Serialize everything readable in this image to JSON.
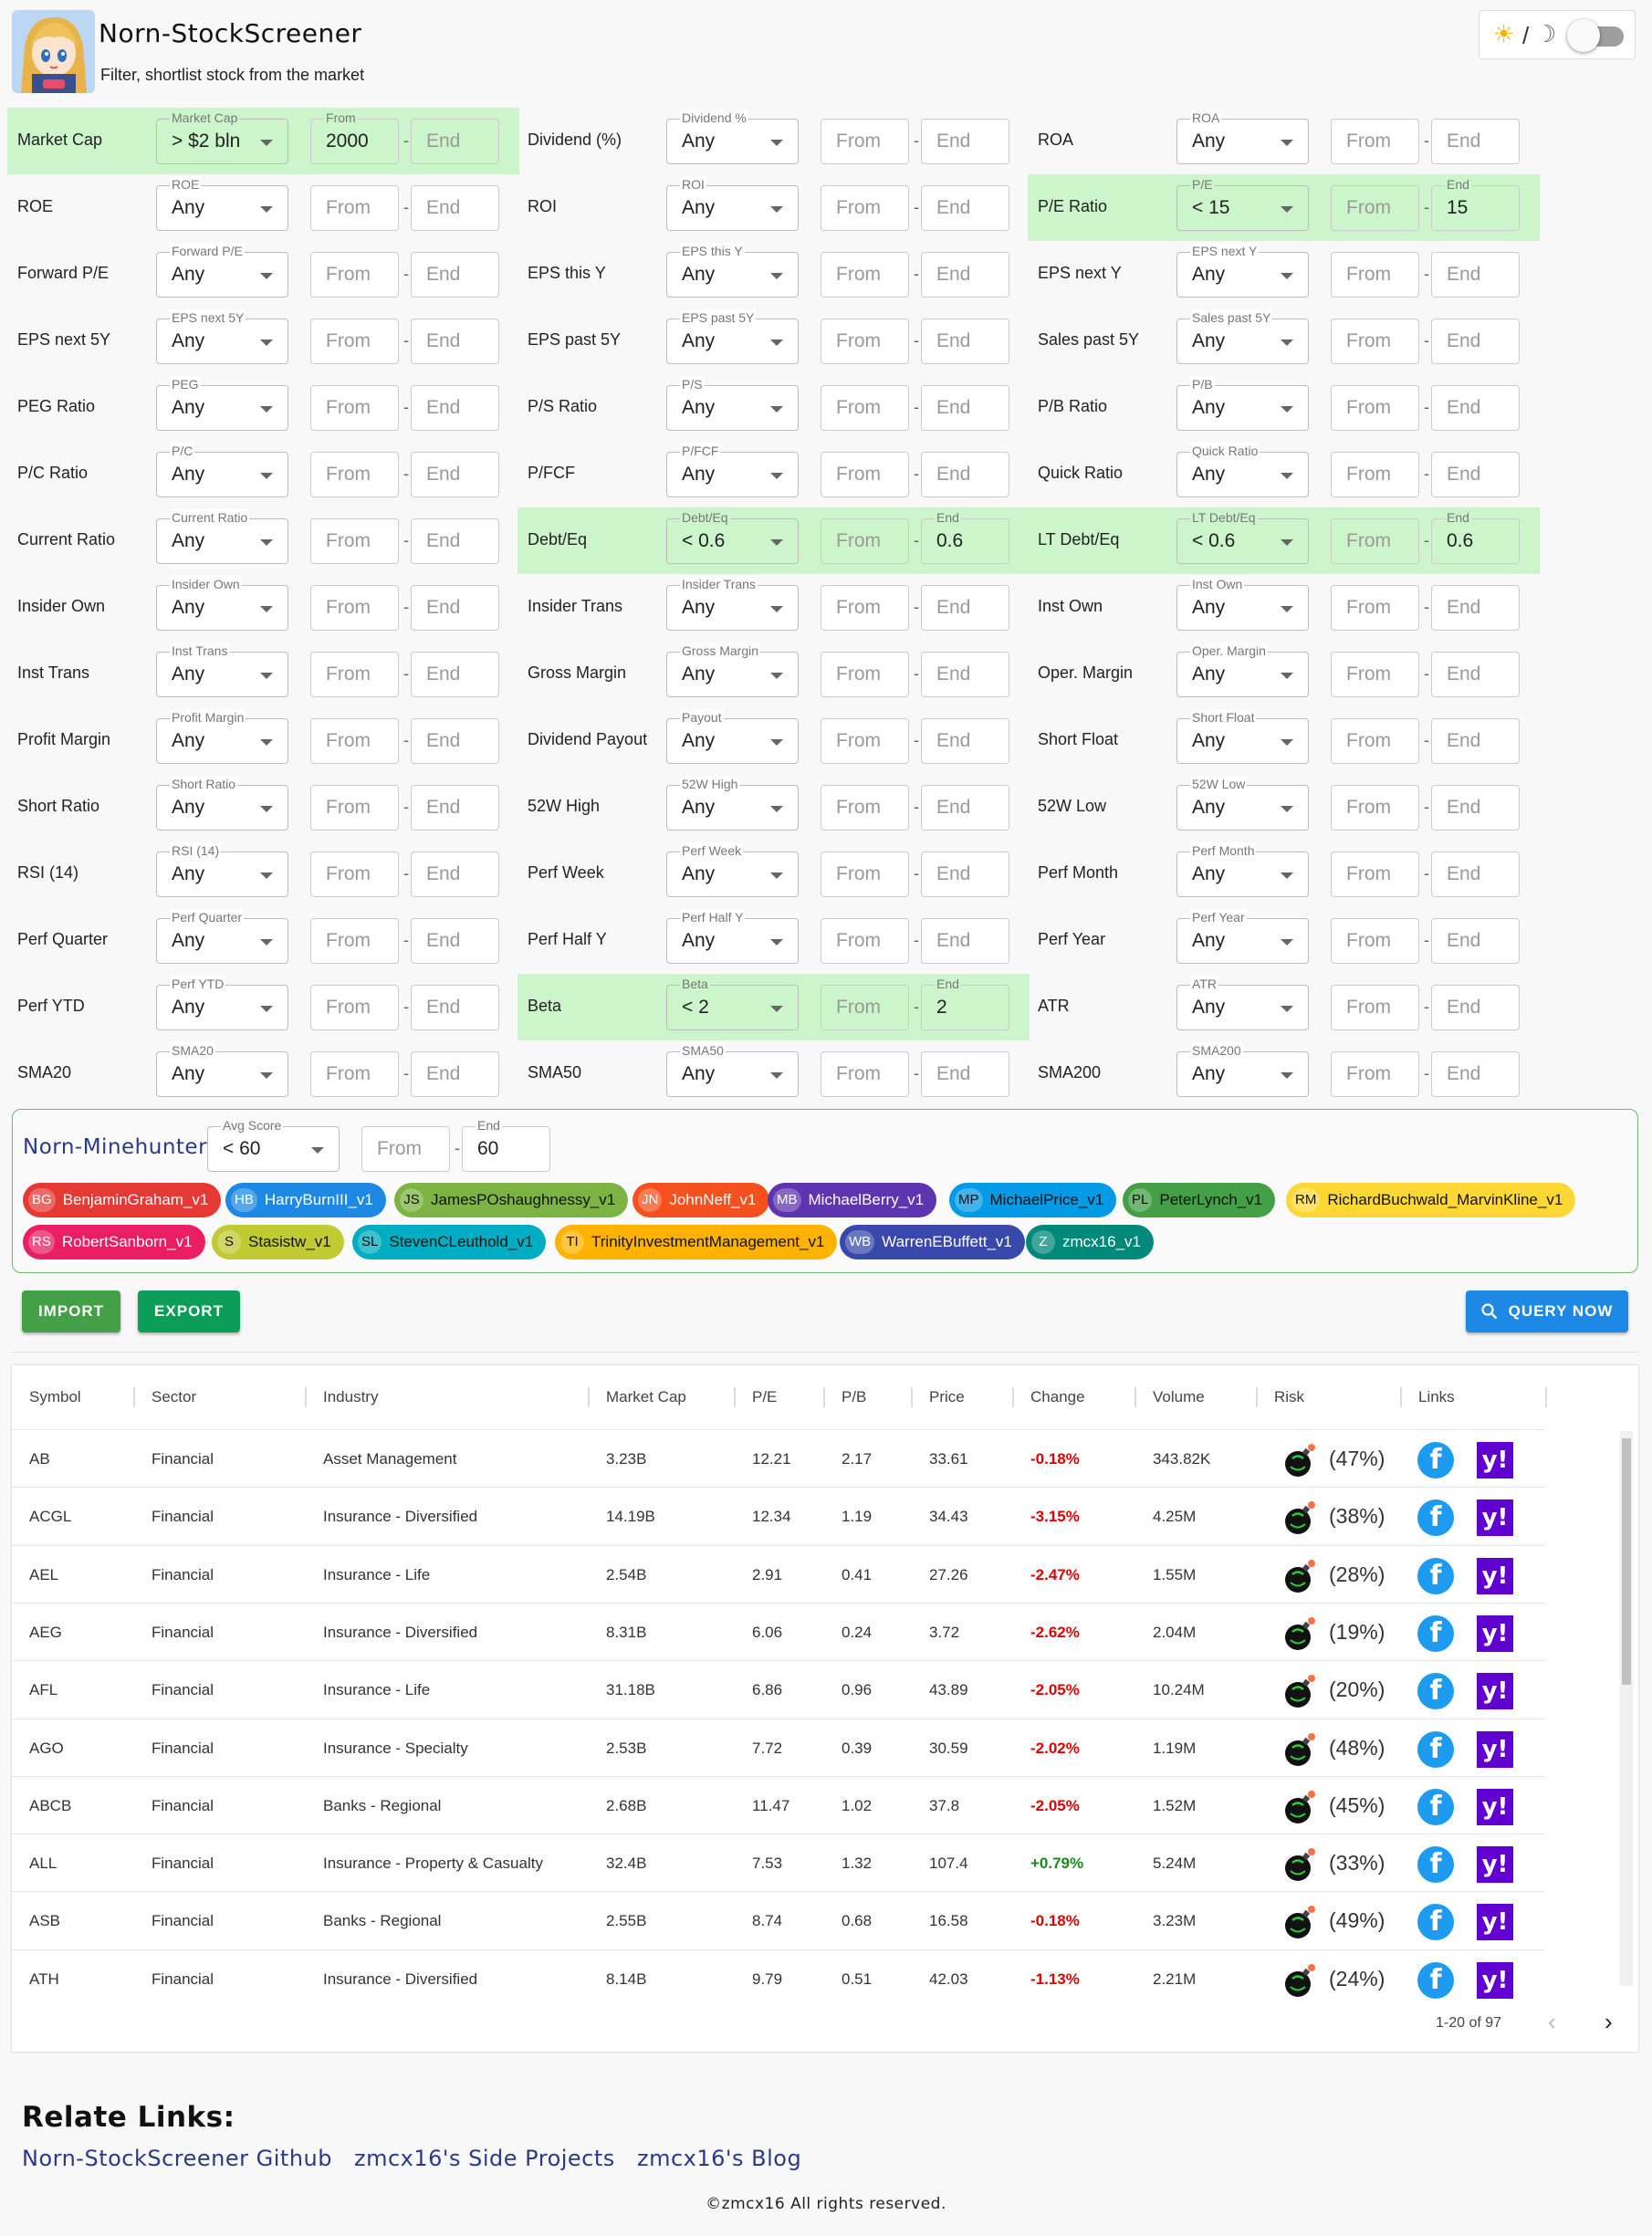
{
  "header": {
    "title": "Norn-StockScreener",
    "subtitle": "Filter, shortlist stock from the market",
    "theme_slash": "/",
    "sun_icon": "☀",
    "moon_icon": "☽"
  },
  "placeholders": {
    "from": "From",
    "end": "End"
  },
  "filters": [
    [
      {
        "label": "Market Cap",
        "legend": "Market Cap",
        "value": "> $2 bln",
        "from": "2000",
        "end": "",
        "from_legend": "From",
        "end_legend": "",
        "hl": true
      },
      {
        "label": "Dividend (%)",
        "legend": "Dividend %",
        "value": "Any",
        "from": "",
        "end": "",
        "hl": false
      },
      {
        "label": "ROA",
        "legend": "ROA",
        "value": "Any",
        "from": "",
        "end": "",
        "hl": false
      }
    ],
    [
      {
        "label": "ROE",
        "legend": "ROE",
        "value": "Any",
        "from": "",
        "end": "",
        "hl": false
      },
      {
        "label": "ROI",
        "legend": "ROI",
        "value": "Any",
        "from": "",
        "end": "",
        "hl": false
      },
      {
        "label": "P/E Ratio",
        "legend": "P/E",
        "value": "< 15",
        "from": "",
        "end": "15",
        "from_legend": "",
        "end_legend": "End",
        "hl": true
      }
    ],
    [
      {
        "label": "Forward P/E",
        "legend": "Forward P/E",
        "value": "Any",
        "from": "",
        "end": "",
        "hl": false
      },
      {
        "label": "EPS this Y",
        "legend": "EPS this Y",
        "value": "Any",
        "from": "",
        "end": "",
        "hl": false
      },
      {
        "label": "EPS next Y",
        "legend": "EPS next Y",
        "value": "Any",
        "from": "",
        "end": "",
        "hl": false
      }
    ],
    [
      {
        "label": "EPS next 5Y",
        "legend": "EPS next 5Y",
        "value": "Any",
        "from": "",
        "end": "",
        "hl": false
      },
      {
        "label": "EPS past 5Y",
        "legend": "EPS past 5Y",
        "value": "Any",
        "from": "",
        "end": "",
        "hl": false
      },
      {
        "label": "Sales past 5Y",
        "legend": "Sales past 5Y",
        "value": "Any",
        "from": "",
        "end": "",
        "hl": false
      }
    ],
    [
      {
        "label": "PEG Ratio",
        "legend": "PEG",
        "value": "Any",
        "from": "",
        "end": "",
        "hl": false
      },
      {
        "label": "P/S Ratio",
        "legend": "P/S",
        "value": "Any",
        "from": "",
        "end": "",
        "hl": false
      },
      {
        "label": "P/B Ratio",
        "legend": "P/B",
        "value": "Any",
        "from": "",
        "end": "",
        "hl": false
      }
    ],
    [
      {
        "label": "P/C Ratio",
        "legend": "P/C",
        "value": "Any",
        "from": "",
        "end": "",
        "hl": false
      },
      {
        "label": "P/FCF",
        "legend": "P/FCF",
        "value": "Any",
        "from": "",
        "end": "",
        "hl": false
      },
      {
        "label": "Quick Ratio",
        "legend": "Quick Ratio",
        "value": "Any",
        "from": "",
        "end": "",
        "hl": false
      }
    ],
    [
      {
        "label": "Current Ratio",
        "legend": "Current Ratio",
        "value": "Any",
        "from": "",
        "end": "",
        "hl": false
      },
      {
        "label": "Debt/Eq",
        "legend": "Debt/Eq",
        "value": "< 0.6",
        "from": "",
        "end": "0.6",
        "from_legend": "",
        "end_legend": "End",
        "hl": true
      },
      {
        "label": "LT Debt/Eq",
        "legend": "LT Debt/Eq",
        "value": "< 0.6",
        "from": "",
        "end": "0.6",
        "from_legend": "",
        "end_legend": "End",
        "hl": true
      }
    ],
    [
      {
        "label": "Insider Own",
        "legend": "Insider Own",
        "value": "Any",
        "from": "",
        "end": "",
        "hl": false
      },
      {
        "label": "Insider Trans",
        "legend": "Insider Trans",
        "value": "Any",
        "from": "",
        "end": "",
        "hl": false
      },
      {
        "label": "Inst Own",
        "legend": "Inst Own",
        "value": "Any",
        "from": "",
        "end": "",
        "hl": false
      }
    ],
    [
      {
        "label": "Inst Trans",
        "legend": "Inst Trans",
        "value": "Any",
        "from": "",
        "end": "",
        "hl": false
      },
      {
        "label": "Gross Margin",
        "legend": "Gross Margin",
        "value": "Any",
        "from": "",
        "end": "",
        "hl": false
      },
      {
        "label": "Oper. Margin",
        "legend": "Oper. Margin",
        "value": "Any",
        "from": "",
        "end": "",
        "hl": false
      }
    ],
    [
      {
        "label": "Profit Margin",
        "legend": "Profit Margin",
        "value": "Any",
        "from": "",
        "end": "",
        "hl": false
      },
      {
        "label": "Dividend Payout",
        "legend": "Payout",
        "value": "Any",
        "from": "",
        "end": "",
        "hl": false
      },
      {
        "label": "Short Float",
        "legend": "Short Float",
        "value": "Any",
        "from": "",
        "end": "",
        "hl": false
      }
    ],
    [
      {
        "label": "Short Ratio",
        "legend": "Short Ratio",
        "value": "Any",
        "from": "",
        "end": "",
        "hl": false
      },
      {
        "label": "52W High",
        "legend": "52W High",
        "value": "Any",
        "from": "",
        "end": "",
        "hl": false
      },
      {
        "label": "52W Low",
        "legend": "52W Low",
        "value": "Any",
        "from": "",
        "end": "",
        "hl": false
      }
    ],
    [
      {
        "label": "RSI (14)",
        "legend": "RSI (14)",
        "value": "Any",
        "from": "",
        "end": "",
        "hl": false
      },
      {
        "label": "Perf Week",
        "legend": "Perf Week",
        "value": "Any",
        "from": "",
        "end": "",
        "hl": false
      },
      {
        "label": "Perf Month",
        "legend": "Perf Month",
        "value": "Any",
        "from": "",
        "end": "",
        "hl": false
      }
    ],
    [
      {
        "label": "Perf Quarter",
        "legend": "Perf Quarter",
        "value": "Any",
        "from": "",
        "end": "",
        "hl": false
      },
      {
        "label": "Perf Half Y",
        "legend": "Perf Half Y",
        "value": "Any",
        "from": "",
        "end": "",
        "hl": false
      },
      {
        "label": "Perf Year",
        "legend": "Perf Year",
        "value": "Any",
        "from": "",
        "end": "",
        "hl": false
      }
    ],
    [
      {
        "label": "Perf YTD",
        "legend": "Perf YTD",
        "value": "Any",
        "from": "",
        "end": "",
        "hl": false
      },
      {
        "label": "Beta",
        "legend": "Beta",
        "value": "< 2",
        "from": "",
        "end": "2",
        "from_legend": "",
        "end_legend": "End",
        "hl": true
      },
      {
        "label": "ATR",
        "legend": "ATR",
        "value": "Any",
        "from": "",
        "end": "",
        "hl": false
      }
    ],
    [
      {
        "label": "SMA20",
        "legend": "SMA20",
        "value": "Any",
        "from": "",
        "end": "",
        "hl": false
      },
      {
        "label": "SMA50",
        "legend": "SMA50",
        "value": "Any",
        "from": "",
        "end": "",
        "hl": false
      },
      {
        "label": "SMA200",
        "legend": "SMA200",
        "value": "Any",
        "from": "",
        "end": "",
        "hl": false
      }
    ]
  ],
  "minehunter": {
    "title": "Norn-Minehunter",
    "legend": "Avg Score",
    "value": "< 60",
    "from": "",
    "end": "60",
    "end_legend": "End",
    "chips": [
      {
        "ini": "BG",
        "label": "BenjaminGraham_v1",
        "bg": "#e53935",
        "fg": "#ffffff"
      },
      {
        "ini": "HB",
        "label": "HarryBurnIII_v1",
        "bg": "#1e88e5",
        "fg": "#ffffff"
      },
      {
        "ini": "JS",
        "label": "JamesPOshaughnessy_v1",
        "bg": "#7cb342",
        "fg": "#111111"
      },
      {
        "ini": "JN",
        "label": "JohnNeff_v1",
        "bg": "#f4511e",
        "fg": "#ffffff"
      },
      {
        "ini": "MB",
        "label": "MichaelBerry_v1",
        "bg": "#5e35b1",
        "fg": "#ffffff"
      },
      {
        "ini": "MP",
        "label": "MichaelPrice_v1",
        "bg": "#039be5",
        "fg": "#111111"
      },
      {
        "ini": "PL",
        "label": "PeterLynch_v1",
        "bg": "#43a047",
        "fg": "#111111"
      },
      {
        "ini": "RM",
        "label": "RichardBuchwald_MarvinKline_v1",
        "bg": "#fdd835",
        "fg": "#111111"
      },
      {
        "ini": "RS",
        "label": "RobertSanborn_v1",
        "bg": "#e91e63",
        "fg": "#ffffff"
      },
      {
        "ini": "S",
        "label": "Stasistw_v1",
        "bg": "#c0ca33",
        "fg": "#111111"
      },
      {
        "ini": "SL",
        "label": "StevenCLeuthold_v1",
        "bg": "#00acc1",
        "fg": "#111111"
      },
      {
        "ini": "TI",
        "label": "TrinityInvestmentManagement_v1",
        "bg": "#ffb300",
        "fg": "#111111"
      },
      {
        "ini": "WB",
        "label": "WarrenEBuffett_v1",
        "bg": "#3949ab",
        "fg": "#ffffff"
      },
      {
        "ini": "Z",
        "label": "zmcx16_v1",
        "bg": "#00897b",
        "fg": "#ffffff"
      }
    ]
  },
  "actions": {
    "import": "IMPORT",
    "export": "EXPORT",
    "query": "QUERY NOW",
    "import_color": "#43a047",
    "export_color": "#0c9d58",
    "query_color": "#1e88e5"
  },
  "table": {
    "columns": [
      "Symbol",
      "Sector",
      "Industry",
      "Market Cap",
      "P/E",
      "P/B",
      "Price",
      "Change",
      "Volume",
      "Risk",
      "Links"
    ],
    "rows": [
      [
        "AB",
        "Financial",
        "Asset Management",
        "3.23B",
        "12.21",
        "2.17",
        "33.61",
        "-0.18%",
        "343.82K",
        "(47%)"
      ],
      [
        "ACGL",
        "Financial",
        "Insurance - Diversified",
        "14.19B",
        "12.34",
        "1.19",
        "34.43",
        "-3.15%",
        "4.25M",
        "(38%)"
      ],
      [
        "AEL",
        "Financial",
        "Insurance - Life",
        "2.54B",
        "2.91",
        "0.41",
        "27.26",
        "-2.47%",
        "1.55M",
        "(28%)"
      ],
      [
        "AEG",
        "Financial",
        "Insurance - Diversified",
        "8.31B",
        "6.06",
        "0.24",
        "3.72",
        "-2.62%",
        "2.04M",
        "(19%)"
      ],
      [
        "AFL",
        "Financial",
        "Insurance - Life",
        "31.18B",
        "6.86",
        "0.96",
        "43.89",
        "-2.05%",
        "10.24M",
        "(20%)"
      ],
      [
        "AGO",
        "Financial",
        "Insurance - Specialty",
        "2.53B",
        "7.72",
        "0.39",
        "30.59",
        "-2.02%",
        "1.19M",
        "(48%)"
      ],
      [
        "ABCB",
        "Financial",
        "Banks - Regional",
        "2.68B",
        "11.47",
        "1.02",
        "37.8",
        "-2.05%",
        "1.52M",
        "(45%)"
      ],
      [
        "ALL",
        "Financial",
        "Insurance - Property & Casualty",
        "32.4B",
        "7.53",
        "1.32",
        "107.4",
        "+0.79%",
        "5.24M",
        "(33%)"
      ],
      [
        "ASB",
        "Financial",
        "Banks - Regional",
        "2.55B",
        "8.74",
        "0.68",
        "16.58",
        "-0.18%",
        "3.23M",
        "(49%)"
      ],
      [
        "ATH",
        "Financial",
        "Insurance - Diversified",
        "8.14B",
        "9.79",
        "0.51",
        "42.03",
        "-1.13%",
        "2.21M",
        "(24%)"
      ]
    ],
    "pagination": "1-20 of 97",
    "prev_icon": "‹",
    "next_icon": "›",
    "links_icons": {
      "fb": "f",
      "yahoo": "y!"
    }
  },
  "related": {
    "title": "Relate Links:",
    "links": [
      "Norn-StockScreener Github",
      "zmcx16's Side Projects",
      "zmcx16's Blog"
    ]
  },
  "footer": "©zmcx16 All rights reserved."
}
